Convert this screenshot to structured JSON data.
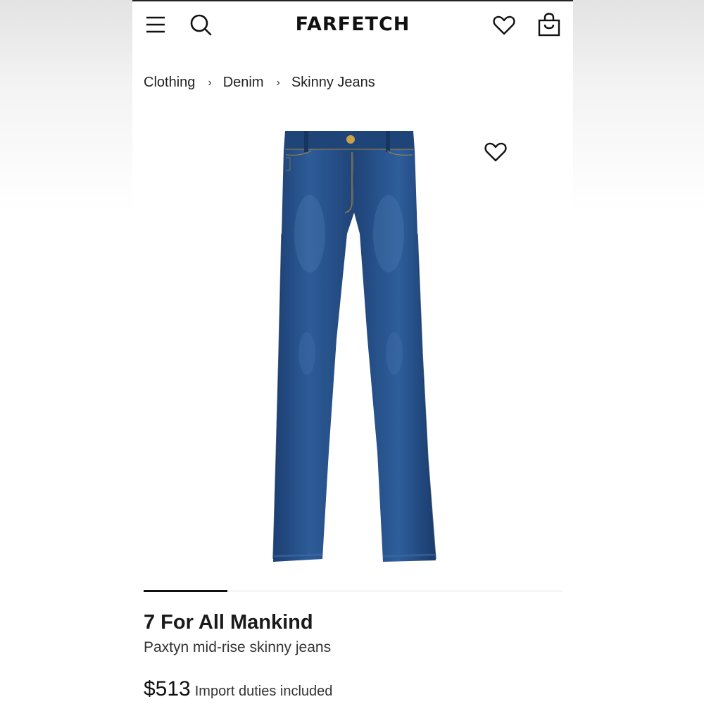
{
  "header": {
    "logo": "FARFETCH",
    "icons": {
      "menu": "menu-icon",
      "search": "search-icon",
      "wishlist": "heart-icon",
      "bag": "shopping-bag-icon"
    }
  },
  "breadcrumb": [
    {
      "label": "Clothing"
    },
    {
      "label": "Denim"
    },
    {
      "label": "Skinny Jeans"
    }
  ],
  "breadcrumb_separator": "›",
  "image": {
    "subject": "dark-wash-skinny-jeans",
    "wishlist_icon": "heart-icon",
    "carousel_progress": 0.2
  },
  "product": {
    "brand": "7 For All Mankind",
    "name": "Paxtyn mid-rise skinny jeans",
    "price": "$513",
    "duties_note": "Import duties included"
  },
  "colors": {
    "text": "#111111",
    "denim": "#254f8a"
  }
}
